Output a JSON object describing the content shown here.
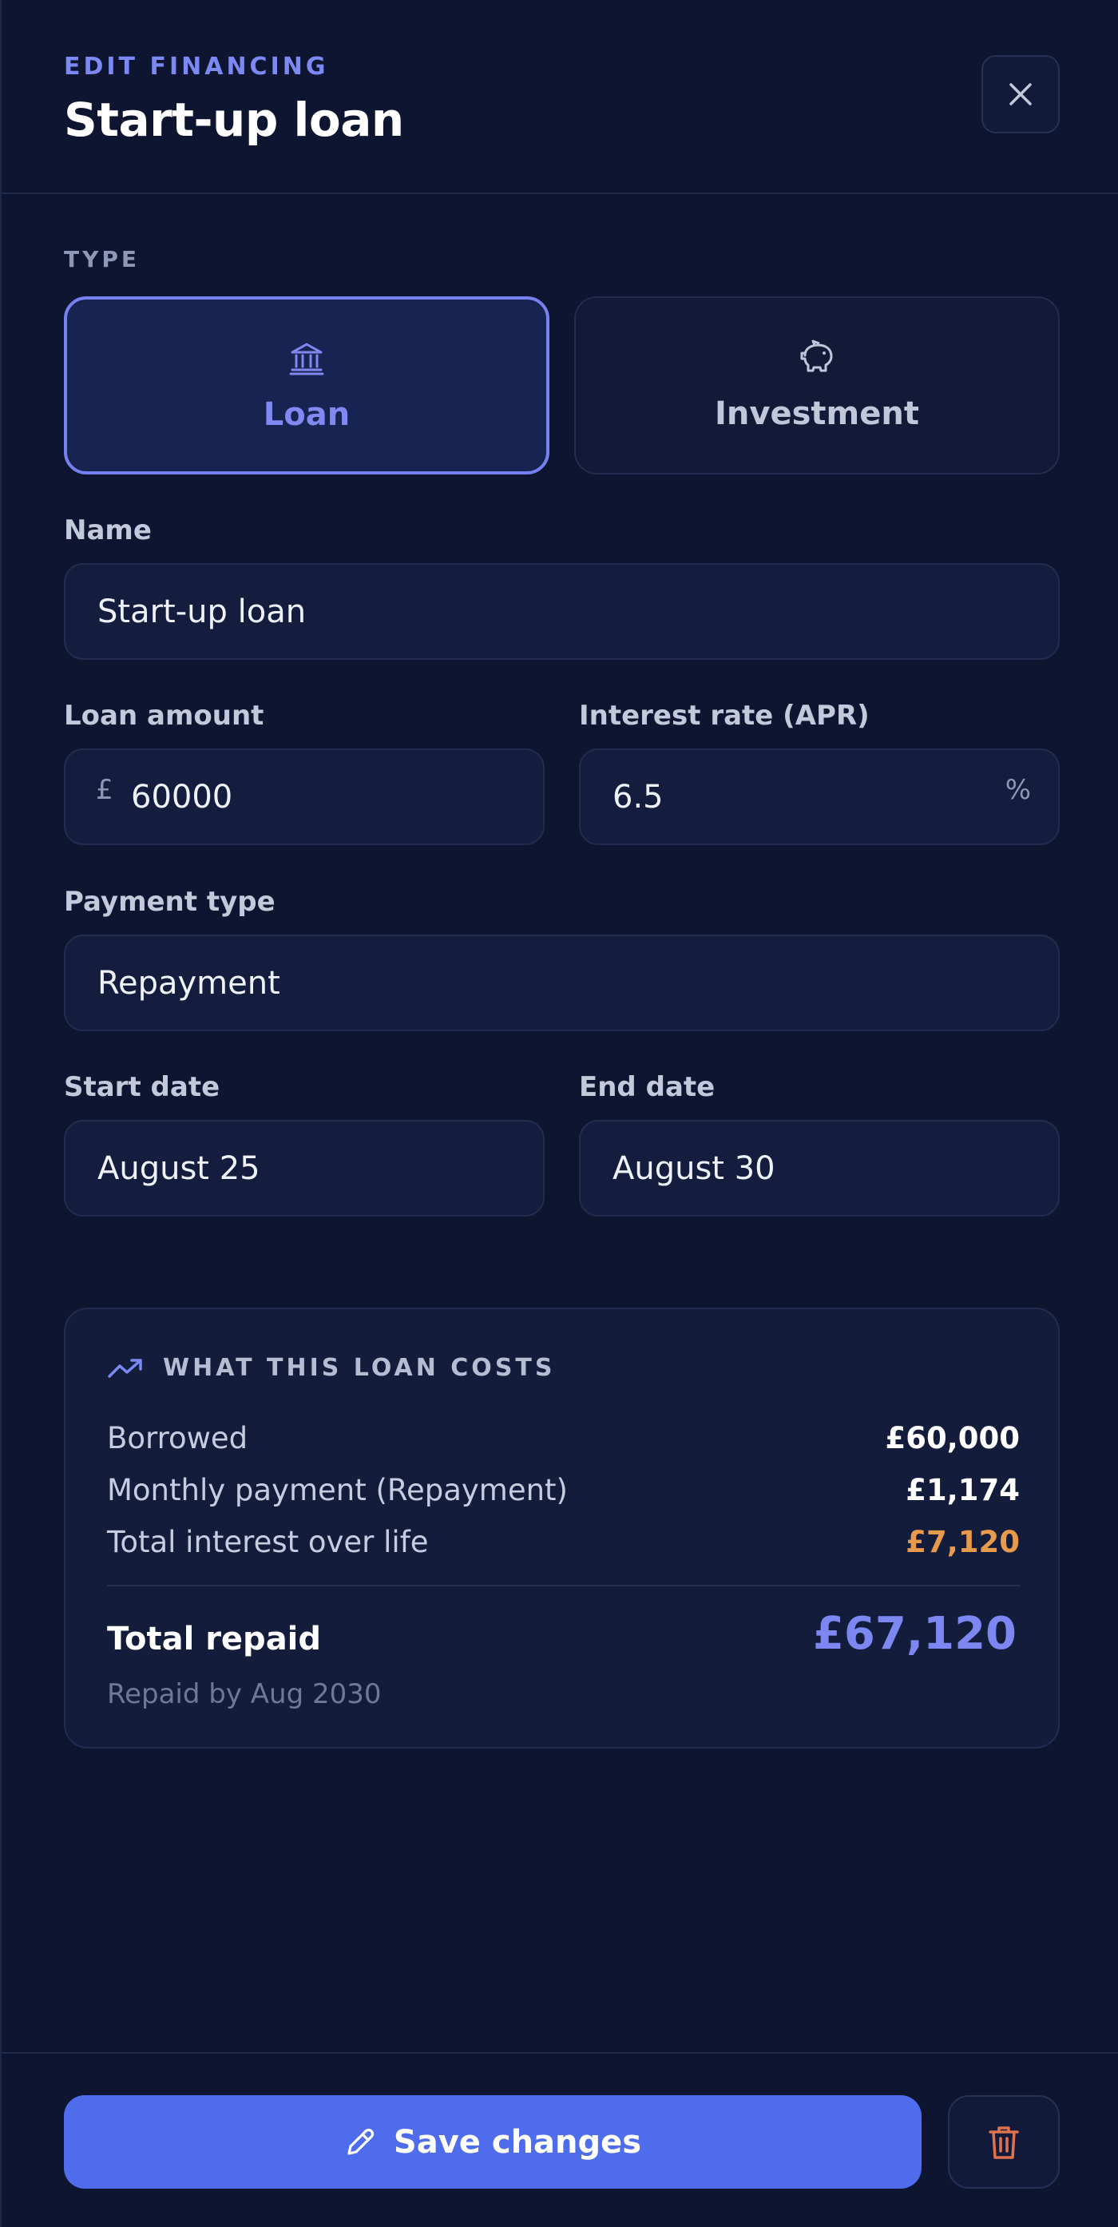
{
  "header": {
    "eyebrow": "EDIT FINANCING",
    "title": "Start-up loan",
    "close_icon": "close-icon"
  },
  "type_section": {
    "label": "TYPE",
    "options": [
      {
        "label": "Loan",
        "icon": "bank-icon",
        "selected": true
      },
      {
        "label": "Investment",
        "icon": "piggy-bank-icon",
        "selected": false
      }
    ]
  },
  "form": {
    "name": {
      "label": "Name",
      "value": "Start-up loan"
    },
    "loan_amount": {
      "label": "Loan amount",
      "prefix": "£",
      "value": "60000"
    },
    "interest_rate": {
      "label": "Interest rate (APR)",
      "value": "6.5",
      "suffix": "%"
    },
    "payment_type": {
      "label": "Payment type",
      "value": "Repayment"
    },
    "start_date": {
      "label": "Start date",
      "value": "August 25"
    },
    "end_date": {
      "label": "End date",
      "value": "August 30"
    }
  },
  "summary": {
    "title": "WHAT THIS LOAN COSTS",
    "icon": "trending-up-icon",
    "rows": [
      {
        "label": "Borrowed",
        "value": "£60,000"
      },
      {
        "label": "Monthly payment (Repayment)",
        "value": "£1,174"
      },
      {
        "label": "Total interest over life",
        "value": "£7,120"
      }
    ],
    "total_label": "Total repaid",
    "total_value": "£67,120",
    "total_sub": "Repaid by Aug 2030"
  },
  "footer": {
    "save_label": "Save changes",
    "save_icon": "pencil-icon",
    "delete_icon": "trash-icon"
  },
  "colors": {
    "background": "#0e1530",
    "accent": "#7680ee",
    "primary_button": "#4e6cec",
    "warning": "#e89a4c",
    "danger": "#e0724e"
  }
}
